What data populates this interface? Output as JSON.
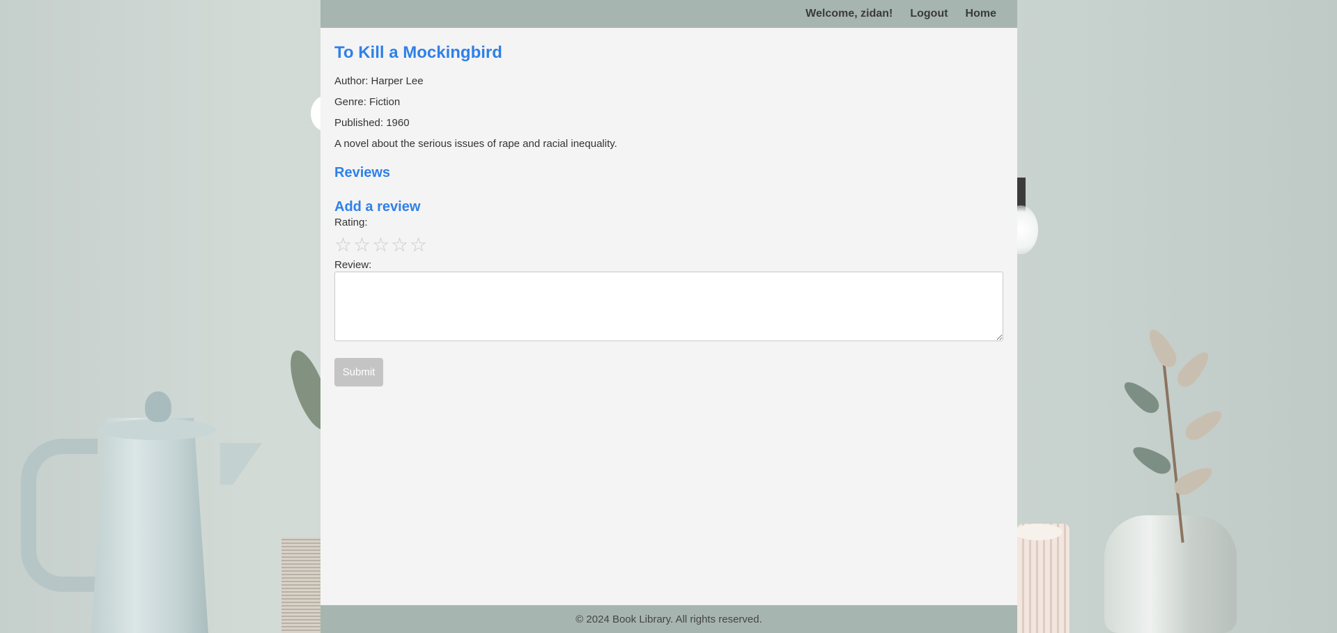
{
  "header": {
    "welcome_text": "Welcome, zidan!",
    "logout_label": "Logout",
    "home_label": "Home"
  },
  "book": {
    "title": "To Kill a Mockingbird",
    "author": "Author: Harper Lee",
    "genre": "Genre: Fiction",
    "published": "Published: 1960",
    "description": "A novel about the serious issues of rape and racial inequality."
  },
  "reviews": {
    "heading": "Reviews"
  },
  "add_review": {
    "heading": "Add a review",
    "rating_label": "Rating:",
    "stars": [
      "☆",
      "☆",
      "☆",
      "☆",
      "☆"
    ],
    "rating_value": 0,
    "review_label": "Review:",
    "review_value": "",
    "submit_label": "Submit"
  },
  "footer": {
    "text": "© 2024 Book Library. All rights reserved."
  },
  "colors": {
    "accent": "#2f80e8",
    "bar": "#a7b5b1",
    "panel": "#f4f4f4",
    "submit_disabled": "#c4c4c4"
  }
}
